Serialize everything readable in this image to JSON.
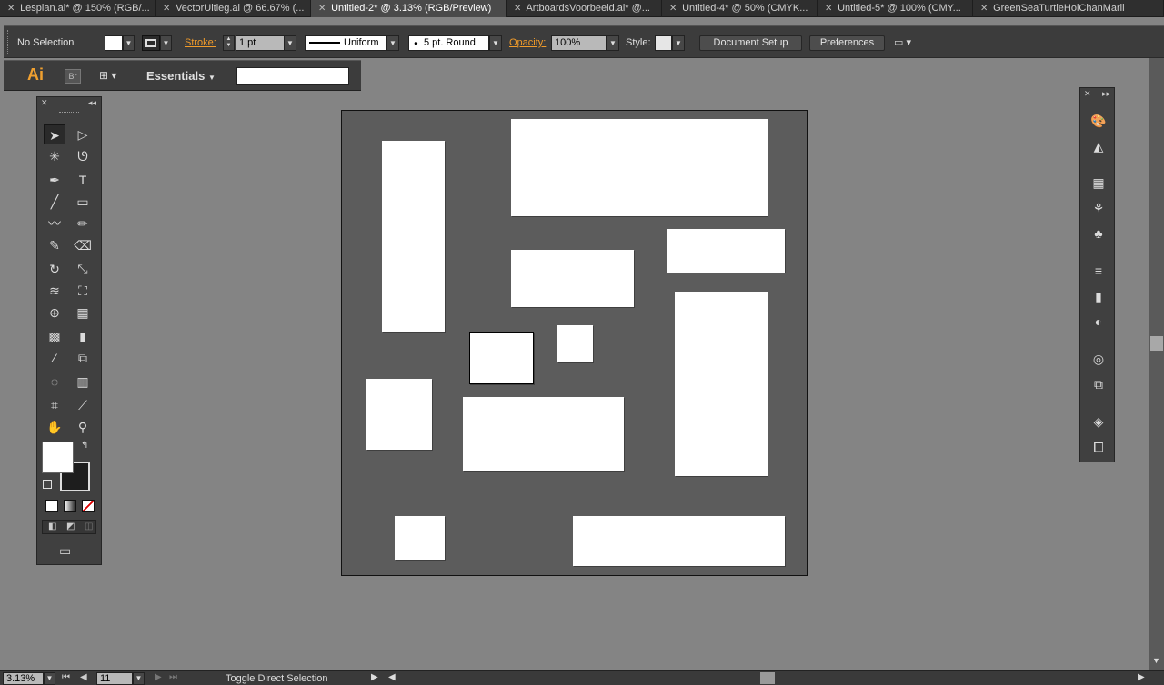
{
  "tabs": [
    {
      "label": "Lesplan.ai* @ 150% (RGB/...",
      "active": false
    },
    {
      "label": "VectorUitleg.ai @ 66.67% (...",
      "active": false
    },
    {
      "label": "Untitled-2* @ 3.13% (RGB/Preview)",
      "active": true
    },
    {
      "label": "ArtboardsVoorbeeld.ai* @...",
      "active": false
    },
    {
      "label": "Untitled-4* @ 50% (CMYK...",
      "active": false
    },
    {
      "label": "Untitled-5* @ 100% (CMY...",
      "active": false
    },
    {
      "label": "GreenSeaTurtleHolChanMarii",
      "active": false
    }
  ],
  "control_bar": {
    "selection_status": "No Selection",
    "stroke_label": "Stroke:",
    "stroke_weight": "1 pt",
    "stroke_profile": "Uniform",
    "brush": "5 pt. Round",
    "opacity_label": "Opacity:",
    "opacity_value": "100%",
    "style_label": "Style:",
    "document_setup": "Document Setup",
    "preferences": "Preferences"
  },
  "app_bar": {
    "logo": "Ai",
    "bridge": "Br",
    "workspace": "Essentials",
    "search_value": ""
  },
  "tools": [
    "selection-tool",
    "direct-selection-tool",
    "magic-wand-tool",
    "lasso-tool",
    "pen-tool",
    "type-tool",
    "line-segment-tool",
    "rectangle-tool",
    "paintbrush-tool",
    "pencil-tool",
    "blob-brush-tool",
    "eraser-tool",
    "rotate-tool",
    "scale-tool",
    "width-tool",
    "free-transform-tool",
    "shape-builder-tool",
    "perspective-grid-tool",
    "mesh-tool",
    "gradient-tool",
    "eyedropper-tool",
    "blend-tool",
    "symbol-sprayer-tool",
    "column-graph-tool",
    "artboard-tool",
    "slice-tool",
    "hand-tool",
    "zoom-tool"
  ],
  "dock_icons": [
    "color-icon",
    "color-guide-icon",
    "swatches-icon",
    "brushes-icon",
    "symbols-icon",
    "stroke-icon",
    "gradient-icon",
    "transparency-icon",
    "appearance-icon",
    "graphic-styles-icon",
    "layers-icon",
    "artboards-icon"
  ],
  "status_bar": {
    "zoom": "3.13%",
    "artboard_number": "11",
    "status_text": "Toggle Direct Selection"
  },
  "colors": {
    "accent": "#f29c2a",
    "artboard_bg": "#5c5c5c",
    "canvas_bg": "#848484",
    "panel_bg": "#404040"
  }
}
